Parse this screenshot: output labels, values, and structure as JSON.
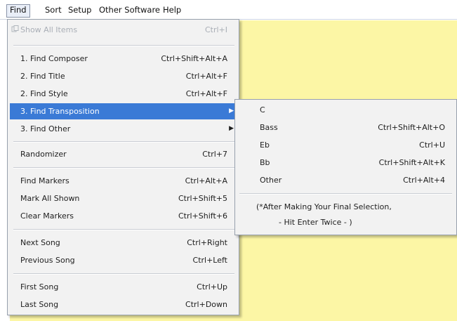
{
  "menubar": {
    "items": [
      "Find",
      "Sort",
      "Setup",
      "Other Software",
      "Help"
    ]
  },
  "find_menu": {
    "show_all": {
      "label": "Show All Items",
      "shortcut": "Ctrl+I",
      "icon": "items-icon"
    },
    "find_composer": {
      "label": "1. Find Composer",
      "shortcut": "Ctrl+Shift+Alt+A"
    },
    "find_title": {
      "label": "2. Find Title",
      "shortcut": "Ctrl+Alt+F"
    },
    "find_style": {
      "label": "2. Find Style",
      "shortcut": "Ctrl+Alt+F"
    },
    "find_transposition": {
      "label": "3. Find Transposition",
      "arrow": "▶"
    },
    "find_other": {
      "label": "3. Find Other",
      "arrow": "▶"
    },
    "randomizer": {
      "label": "Randomizer",
      "shortcut": "Ctrl+7"
    },
    "find_markers": {
      "label": "Find Markers",
      "shortcut": "Ctrl+Alt+A"
    },
    "mark_all_shown": {
      "label": "Mark All Shown",
      "shortcut": "Ctrl+Shift+5"
    },
    "clear_markers": {
      "label": "Clear Markers",
      "shortcut": "Ctrl+Shift+6"
    },
    "next_song": {
      "label": "Next Song",
      "shortcut": "Ctrl+Right"
    },
    "previous_song": {
      "label": "Previous Song",
      "shortcut": "Ctrl+Left"
    },
    "first_song": {
      "label": "First Song",
      "shortcut": "Ctrl+Up"
    },
    "last_song": {
      "label": "Last Song",
      "shortcut": "Ctrl+Down"
    }
  },
  "transposition_submenu": {
    "c": {
      "label": "C",
      "shortcut": ""
    },
    "bass": {
      "label": "Bass",
      "shortcut": "Ctrl+Shift+Alt+O"
    },
    "eb": {
      "label": "Eb",
      "shortcut": "Ctrl+U"
    },
    "bb": {
      "label": "Bb",
      "shortcut": "Ctrl+Shift+Alt+K"
    },
    "other": {
      "label": "Other",
      "shortcut": "Ctrl+Alt+4"
    },
    "note_line1": "(*After Making Your Final Selection,",
    "note_line2": "- Hit Enter Twice -   )"
  },
  "colors": {
    "background": "#fcf6a5",
    "highlight": "#3a7ad6",
    "menu": "#f2f2f2"
  }
}
